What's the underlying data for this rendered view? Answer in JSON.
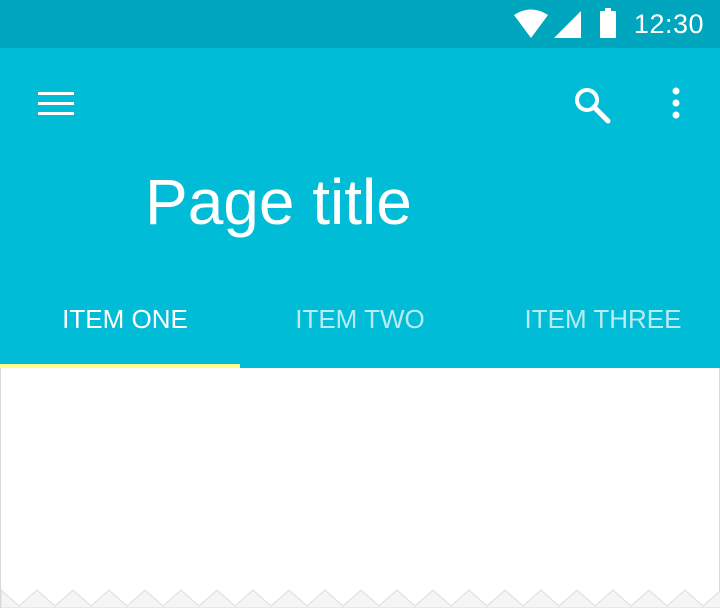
{
  "status_bar": {
    "time": "12:30",
    "icons": [
      "wifi-icon",
      "cellular-signal-icon",
      "battery-icon"
    ]
  },
  "app_bar": {
    "nav_icon": "menu-icon",
    "action_icons": [
      "search-icon",
      "more-vert-icon"
    ],
    "title": "Page title"
  },
  "tabs": [
    {
      "label": "ITEM ONE",
      "selected": true
    },
    {
      "label": "ITEM TWO",
      "selected": false
    },
    {
      "label": "ITEM THREE",
      "selected": false
    }
  ],
  "colors": {
    "status_bar": "#00A6BD",
    "primary": "#00BCD6",
    "tab_indicator": "#FFFF8D",
    "on_primary": "#FFFFFF"
  }
}
